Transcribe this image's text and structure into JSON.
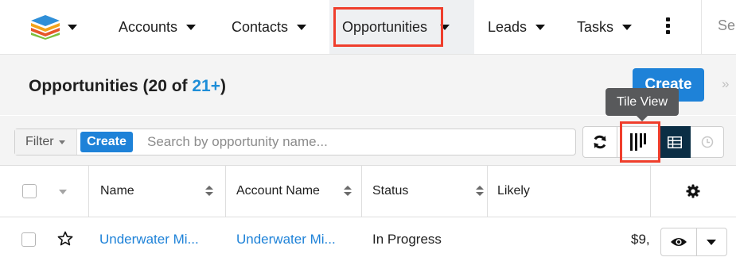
{
  "nav": {
    "items": [
      {
        "label": "Accounts"
      },
      {
        "label": "Contacts"
      },
      {
        "label": "Opportunities"
      },
      {
        "label": "Leads"
      },
      {
        "label": "Tasks"
      }
    ],
    "search_placeholder": "Se"
  },
  "header": {
    "title": "Opportunities",
    "count_prefix": "(20 of ",
    "count_more": "21+",
    "count_suffix": ")",
    "create_label": "Create",
    "collapse_icon": "»"
  },
  "tooltip": {
    "text": "Tile View"
  },
  "filter": {
    "dropdown_label": "Filter",
    "create_label": "Create",
    "search_placeholder": "Search by opportunity name..."
  },
  "table": {
    "columns": [
      "Name",
      "Account Name",
      "Status",
      "Likely"
    ],
    "rows": [
      {
        "name": "Underwater Mi...",
        "account": "Underwater Mi...",
        "status": "In Progress",
        "likely": "$9,"
      }
    ]
  },
  "colors": {
    "accent": "#1e82d8",
    "highlight": "#ef3e2c",
    "list_view_active": "#0b2e45"
  },
  "icons": [
    "sugar-logo-icon",
    "refresh-icon",
    "tile-view-icon",
    "list-view-icon",
    "clock-icon",
    "gear-icon",
    "star-icon",
    "eye-icon",
    "kebab-icon"
  ]
}
